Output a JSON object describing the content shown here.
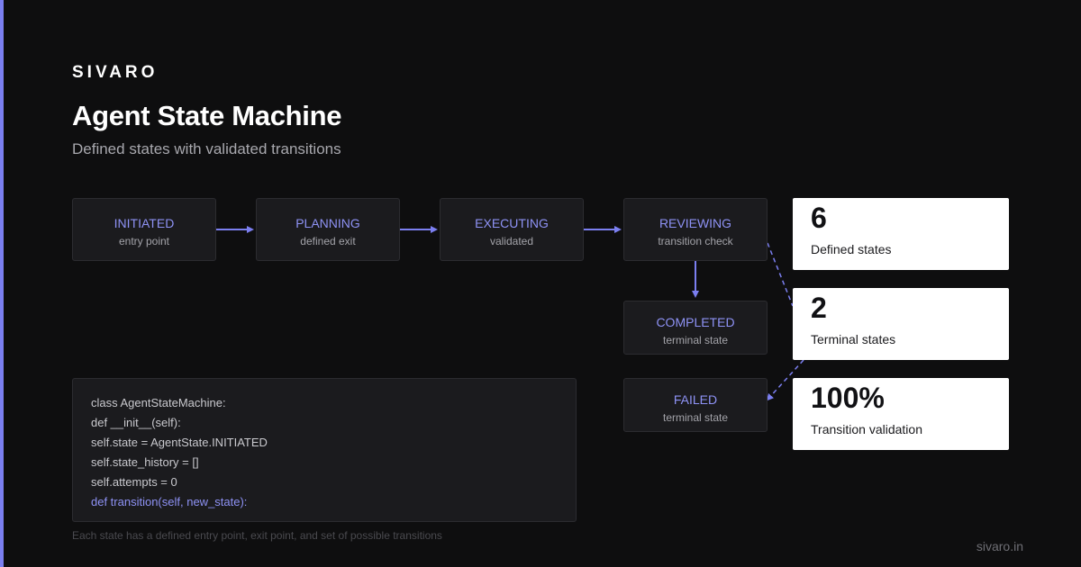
{
  "brand": "SIVARO",
  "title": "Agent State Machine",
  "subtitle": "Defined states with validated transitions",
  "states": {
    "initiated": {
      "name": "INITIATED",
      "sub": "entry point"
    },
    "planning": {
      "name": "PLANNING",
      "sub": "defined exit"
    },
    "executing": {
      "name": "EXECUTING",
      "sub": "validated"
    },
    "reviewing": {
      "name": "REVIEWING",
      "sub": "transition check"
    },
    "completed": {
      "name": "COMPLETED",
      "sub": "terminal state"
    },
    "failed": {
      "name": "FAILED",
      "sub": "terminal state"
    }
  },
  "stats": [
    {
      "value": "6",
      "label": "Defined states"
    },
    {
      "value": "2",
      "label": "Terminal states"
    },
    {
      "value": "100%",
      "label": "Transition validation"
    }
  ],
  "code_lines": [
    "class AgentStateMachine:",
    "def __init__(self):",
    "self.state = AgentState.INITIATED",
    "self.state_history = []",
    "self.attempts = 0",
    "def transition(self, new_state):"
  ],
  "caption": "Each state has a defined entry point, exit point, and set of possible transitions",
  "footer_url": "sivaro.in",
  "colors": {
    "accent": "#7b7ff0",
    "state_label": "#8e92f5",
    "background": "#0e0e0f",
    "card": "#ffffff"
  }
}
